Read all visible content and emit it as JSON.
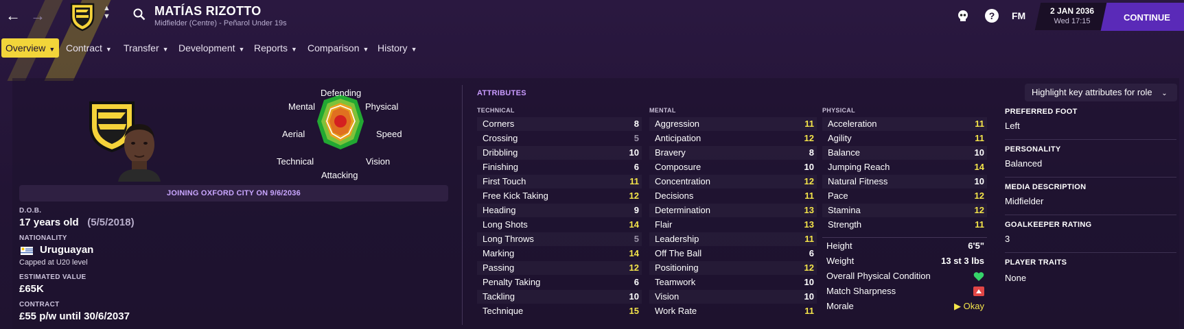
{
  "header": {
    "player_name": "MATÍAS RIZOTTO",
    "player_subtitle": "Midfielder (Centre) - Peñarol Under 19s",
    "fm_label": "FM",
    "date": "2 JAN 2036",
    "day_time": "Wed 17:15",
    "continue_label": "CONTINUE"
  },
  "tabs": [
    {
      "label": "Overview",
      "active": true
    },
    {
      "label": "Contract"
    },
    {
      "label": "Transfer"
    },
    {
      "label": "Development"
    },
    {
      "label": "Reports"
    },
    {
      "label": "Comparison"
    },
    {
      "label": "History"
    }
  ],
  "radar": {
    "defending": "Defending",
    "physical": "Physical",
    "speed": "Speed",
    "vision": "Vision",
    "attacking": "Attacking",
    "technical": "Technical",
    "aerial": "Aerial",
    "mental": "Mental"
  },
  "joining_text": "JOINING OXFORD CITY ON 9/6/2036",
  "profile": {
    "dob_label": "D.O.B.",
    "age": "17 years old",
    "dob": "(5/5/2018)",
    "nationality_label": "NATIONALITY",
    "nationality": "Uruguayan",
    "caps": "Capped at U20 level",
    "value_label": "ESTIMATED VALUE",
    "value": "£65K",
    "contract_label": "CONTRACT",
    "contract": "£55 p/w until 30/6/2037"
  },
  "attributes": {
    "title": "ATTRIBUTES",
    "technical_label": "TECHNICAL",
    "mental_label": "MENTAL",
    "physical_label": "PHYSICAL",
    "technical": [
      {
        "name": "Corners",
        "value": "8"
      },
      {
        "name": "Crossing",
        "value": "5"
      },
      {
        "name": "Dribbling",
        "value": "10"
      },
      {
        "name": "Finishing",
        "value": "6"
      },
      {
        "name": "First Touch",
        "value": "11"
      },
      {
        "name": "Free Kick Taking",
        "value": "12"
      },
      {
        "name": "Heading",
        "value": "9"
      },
      {
        "name": "Long Shots",
        "value": "14"
      },
      {
        "name": "Long Throws",
        "value": "5"
      },
      {
        "name": "Marking",
        "value": "14"
      },
      {
        "name": "Passing",
        "value": "12"
      },
      {
        "name": "Penalty Taking",
        "value": "6"
      },
      {
        "name": "Tackling",
        "value": "10"
      },
      {
        "name": "Technique",
        "value": "15"
      }
    ],
    "mental": [
      {
        "name": "Aggression",
        "value": "11"
      },
      {
        "name": "Anticipation",
        "value": "12"
      },
      {
        "name": "Bravery",
        "value": "8"
      },
      {
        "name": "Composure",
        "value": "10"
      },
      {
        "name": "Concentration",
        "value": "12"
      },
      {
        "name": "Decisions",
        "value": "11"
      },
      {
        "name": "Determination",
        "value": "13"
      },
      {
        "name": "Flair",
        "value": "13"
      },
      {
        "name": "Leadership",
        "value": "11"
      },
      {
        "name": "Off The Ball",
        "value": "6"
      },
      {
        "name": "Positioning",
        "value": "12"
      },
      {
        "name": "Teamwork",
        "value": "10"
      },
      {
        "name": "Vision",
        "value": "10"
      },
      {
        "name": "Work Rate",
        "value": "11"
      }
    ],
    "physical": [
      {
        "name": "Acceleration",
        "value": "11"
      },
      {
        "name": "Agility",
        "value": "11"
      },
      {
        "name": "Balance",
        "value": "10"
      },
      {
        "name": "Jumping Reach",
        "value": "14"
      },
      {
        "name": "Natural Fitness",
        "value": "10"
      },
      {
        "name": "Pace",
        "value": "12"
      },
      {
        "name": "Stamina",
        "value": "12"
      },
      {
        "name": "Strength",
        "value": "11"
      }
    ],
    "physical_extra": {
      "height_label": "Height",
      "height": "6'5\"",
      "weight_label": "Weight",
      "weight": "13 st 3 lbs",
      "condition_label": "Overall Physical Condition",
      "sharpness_label": "Match Sharpness",
      "morale_label": "Morale",
      "morale": "Okay"
    }
  },
  "right_panel": {
    "highlight_label": "Highlight key attributes for role",
    "foot_label": "PREFERRED FOOT",
    "foot": "Left",
    "personality_label": "PERSONALITY",
    "personality": "Balanced",
    "media_label": "MEDIA DESCRIPTION",
    "media": "Midfielder",
    "gk_label": "GOALKEEPER RATING",
    "gk": "3",
    "traits_label": "PLAYER TRAITS",
    "traits": "None"
  },
  "colors": {
    "accent": "#f2d53a",
    "continue": "#5a2ab8",
    "attr_high": "#f4e44a",
    "attr_low": "#9b93a8",
    "joining": "#c9a6ff"
  }
}
